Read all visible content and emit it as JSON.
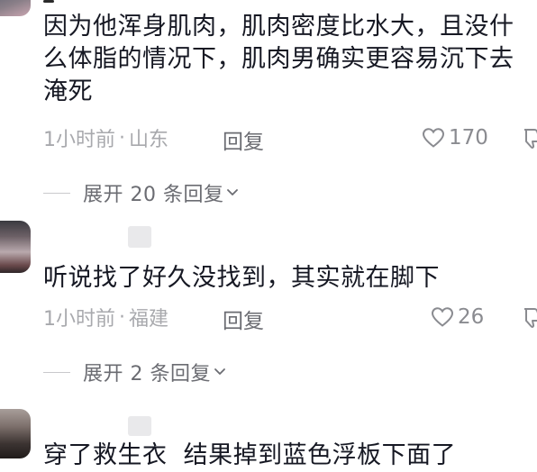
{
  "comments": [
    {
      "text": "因为他浑身肌肉，肌肉密度比水大，且没什么体脂的情况下，肌肉男确实更容易沉下去淹死",
      "time": "1小时前",
      "separator": "·",
      "location": "山东",
      "reply_label": "回复",
      "likes": "170",
      "expand_label": "展开 20 条回复"
    },
    {
      "text": "听说找了好久没找到，其实就在脚下",
      "time": "1小时前",
      "separator": "·",
      "location": "福建",
      "reply_label": "回复",
      "likes": "26",
      "expand_label": "展开 2 条回复"
    },
    {
      "text": "穿了救生衣  结果掉到蓝色浮板下面了"
    }
  ],
  "colors": {
    "text_primary": "#161823",
    "text_secondary": "#a8a9ad",
    "action_gray": "#6b6c72",
    "placeholder": "#e9e9eb"
  },
  "icons": {
    "like": "heart-outline-icon",
    "dislike": "thumbs-down-icon",
    "expand": "chevron-down-icon"
  }
}
